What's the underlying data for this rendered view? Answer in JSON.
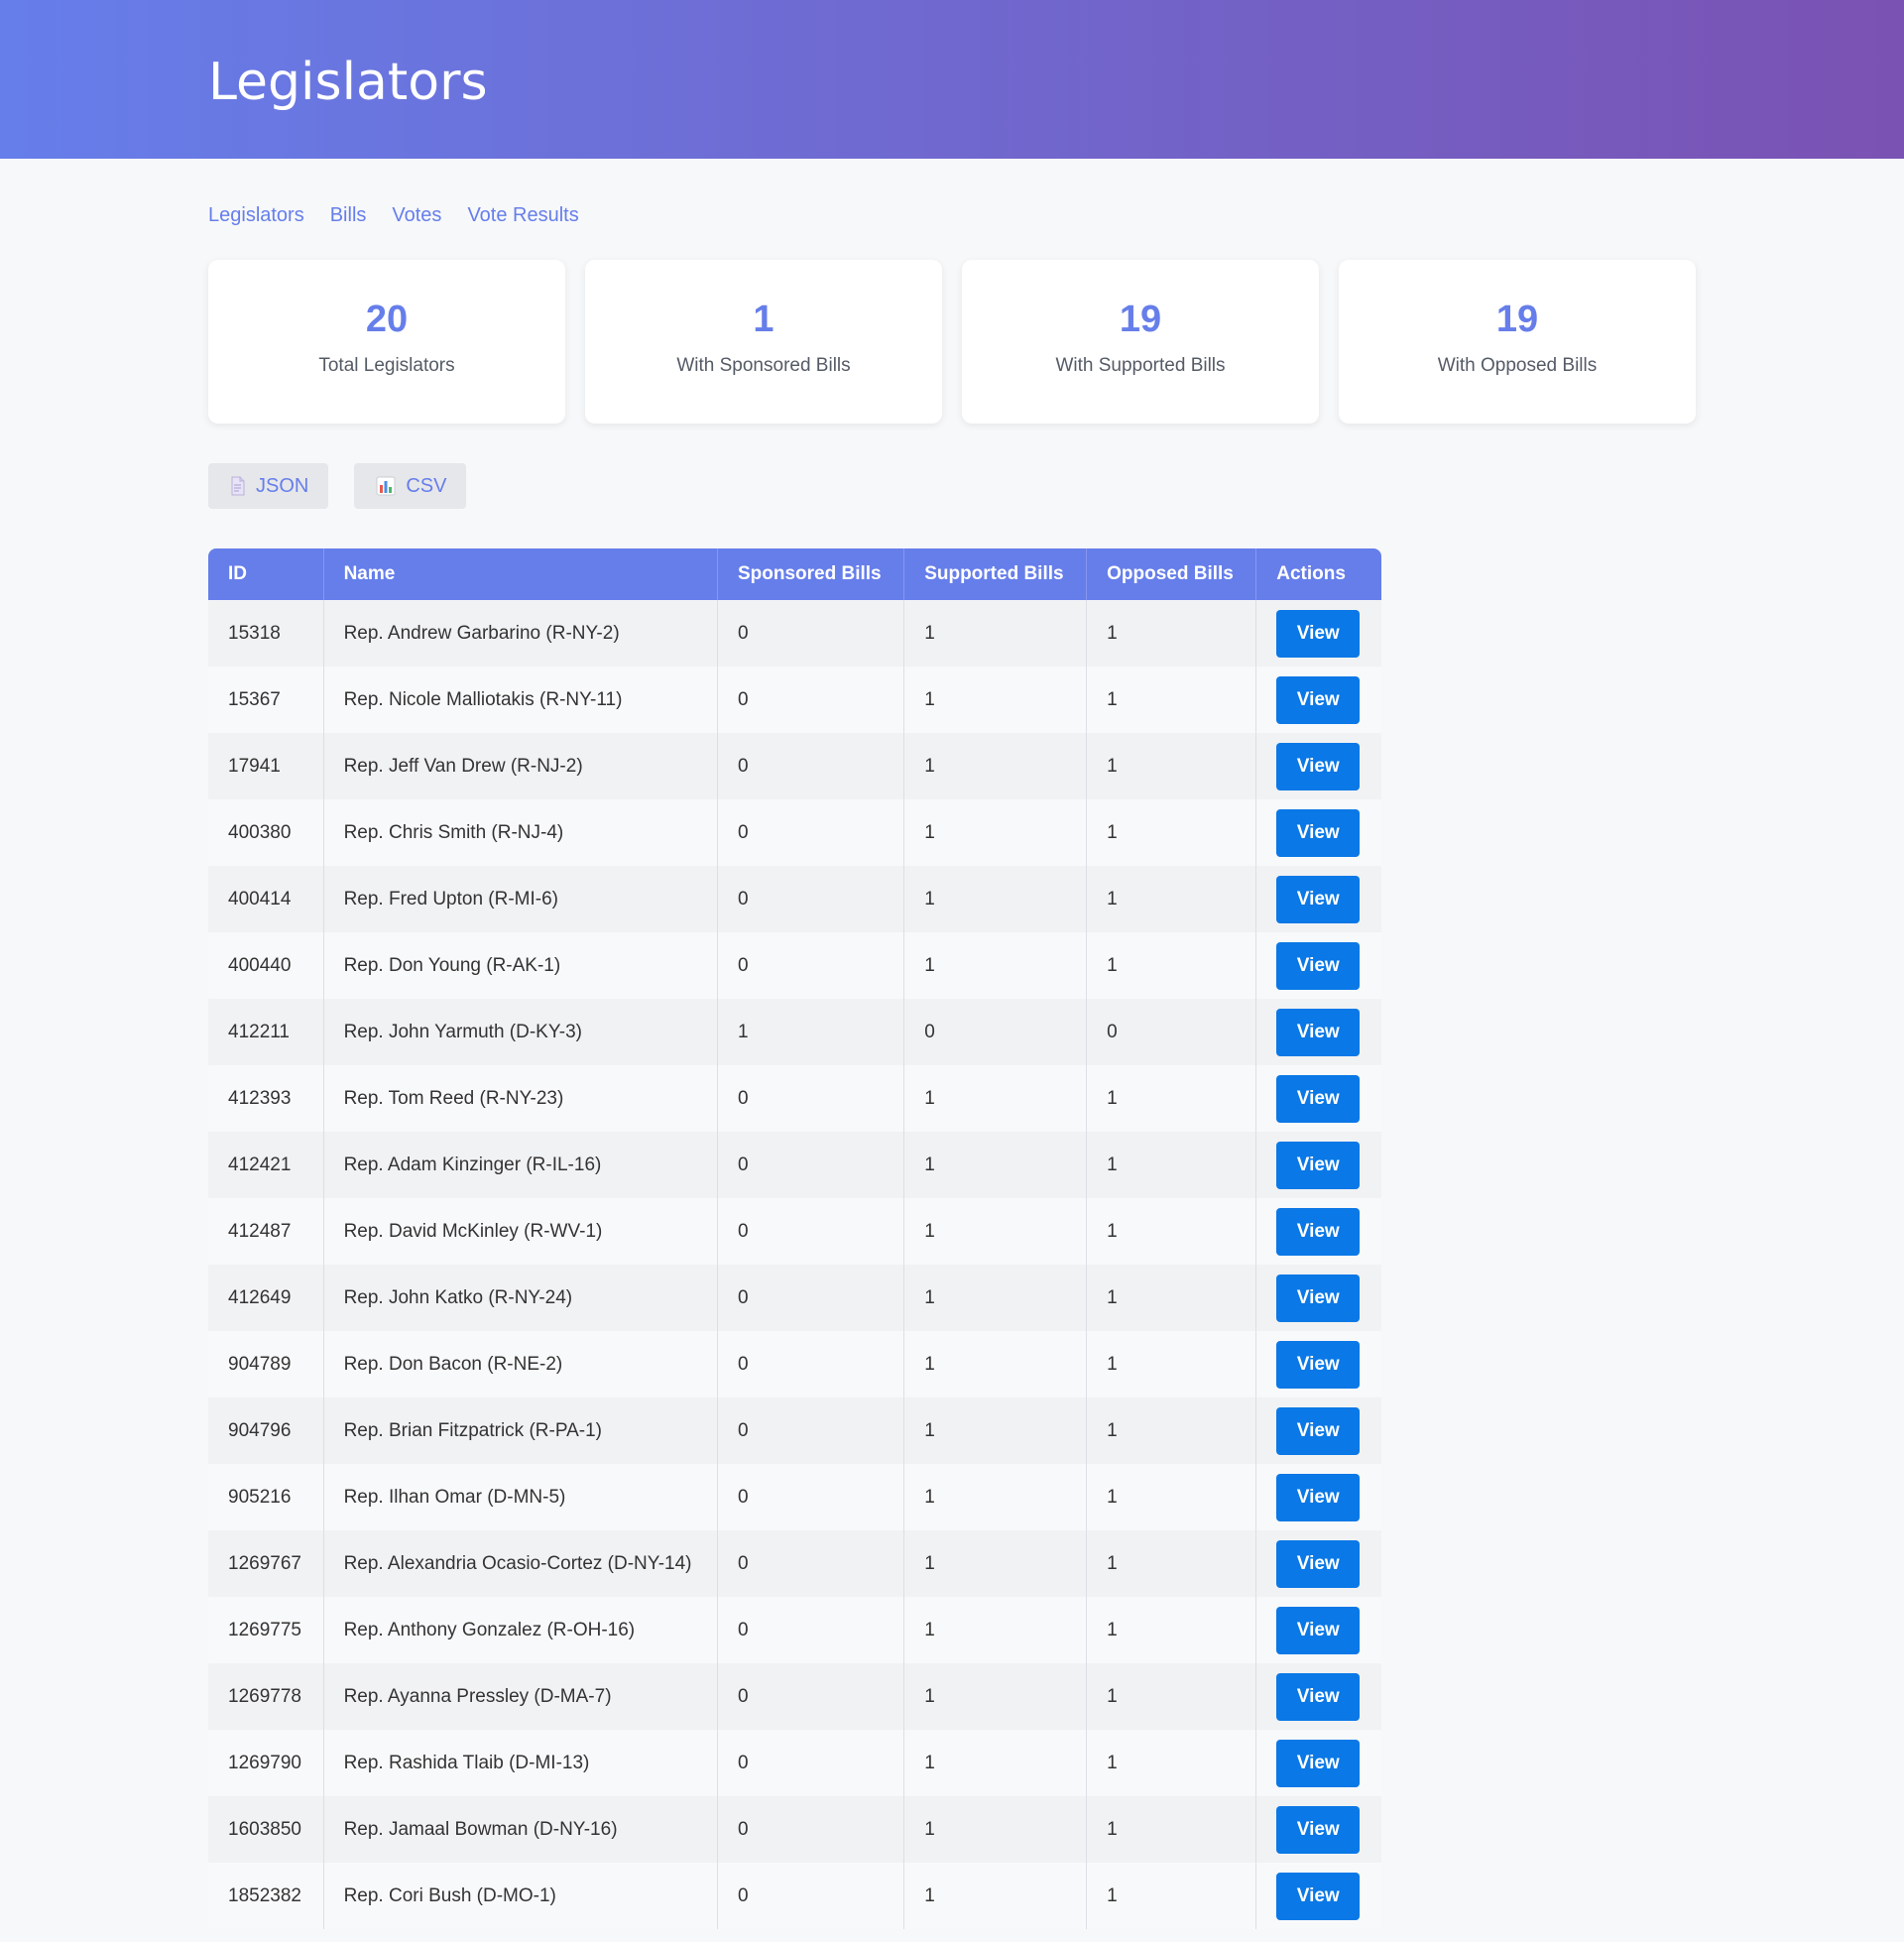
{
  "page": {
    "title": "Legislators"
  },
  "nav": [
    "Legislators",
    "Bills",
    "Votes",
    "Vote Results"
  ],
  "stats": [
    {
      "value": "20",
      "label": "Total Legislators"
    },
    {
      "value": "1",
      "label": "With Sponsored Bills"
    },
    {
      "value": "19",
      "label": "With Supported Bills"
    },
    {
      "value": "19",
      "label": "With Opposed Bills"
    }
  ],
  "exports": [
    {
      "label": "JSON",
      "icon": "document-icon"
    },
    {
      "label": "CSV",
      "icon": "bar-chart-icon"
    }
  ],
  "table": {
    "columns": [
      "ID",
      "Name",
      "Sponsored Bills",
      "Supported Bills",
      "Opposed Bills",
      "Actions"
    ],
    "action_label": "View",
    "rows": [
      {
        "id": "15318",
        "name": "Rep. Andrew Garbarino (R-NY-2)",
        "sponsored": "0",
        "supported": "1",
        "opposed": "1"
      },
      {
        "id": "15367",
        "name": "Rep. Nicole Malliotakis (R-NY-11)",
        "sponsored": "0",
        "supported": "1",
        "opposed": "1"
      },
      {
        "id": "17941",
        "name": "Rep. Jeff Van Drew (R-NJ-2)",
        "sponsored": "0",
        "supported": "1",
        "opposed": "1"
      },
      {
        "id": "400380",
        "name": "Rep. Chris Smith (R-NJ-4)",
        "sponsored": "0",
        "supported": "1",
        "opposed": "1"
      },
      {
        "id": "400414",
        "name": "Rep. Fred Upton (R-MI-6)",
        "sponsored": "0",
        "supported": "1",
        "opposed": "1"
      },
      {
        "id": "400440",
        "name": "Rep. Don Young (R-AK-1)",
        "sponsored": "0",
        "supported": "1",
        "opposed": "1"
      },
      {
        "id": "412211",
        "name": "Rep. John Yarmuth (D-KY-3)",
        "sponsored": "1",
        "supported": "0",
        "opposed": "0"
      },
      {
        "id": "412393",
        "name": "Rep. Tom Reed (R-NY-23)",
        "sponsored": "0",
        "supported": "1",
        "opposed": "1"
      },
      {
        "id": "412421",
        "name": "Rep. Adam Kinzinger (R-IL-16)",
        "sponsored": "0",
        "supported": "1",
        "opposed": "1"
      },
      {
        "id": "412487",
        "name": "Rep. David McKinley (R-WV-1)",
        "sponsored": "0",
        "supported": "1",
        "opposed": "1"
      },
      {
        "id": "412649",
        "name": "Rep. John Katko (R-NY-24)",
        "sponsored": "0",
        "supported": "1",
        "opposed": "1"
      },
      {
        "id": "904789",
        "name": "Rep. Don Bacon (R-NE-2)",
        "sponsored": "0",
        "supported": "1",
        "opposed": "1"
      },
      {
        "id": "904796",
        "name": "Rep. Brian Fitzpatrick (R-PA-1)",
        "sponsored": "0",
        "supported": "1",
        "opposed": "1"
      },
      {
        "id": "905216",
        "name": "Rep. Ilhan Omar (D-MN-5)",
        "sponsored": "0",
        "supported": "1",
        "opposed": "1"
      },
      {
        "id": "1269767",
        "name": "Rep. Alexandria Ocasio-Cortez (D-NY-14)",
        "sponsored": "0",
        "supported": "1",
        "opposed": "1"
      },
      {
        "id": "1269775",
        "name": "Rep. Anthony Gonzalez (R-OH-16)",
        "sponsored": "0",
        "supported": "1",
        "opposed": "1"
      },
      {
        "id": "1269778",
        "name": "Rep. Ayanna Pressley (D-MA-7)",
        "sponsored": "0",
        "supported": "1",
        "opposed": "1"
      },
      {
        "id": "1269790",
        "name": "Rep. Rashida Tlaib (D-MI-13)",
        "sponsored": "0",
        "supported": "1",
        "opposed": "1"
      },
      {
        "id": "1603850",
        "name": "Rep. Jamaal Bowman (D-NY-16)",
        "sponsored": "0",
        "supported": "1",
        "opposed": "1"
      },
      {
        "id": "1852382",
        "name": "Rep. Cori Bush (D-MO-1)",
        "sponsored": "0",
        "supported": "1",
        "opposed": "1"
      }
    ]
  },
  "colors": {
    "accent": "#667eea",
    "header_gradient_start": "#667eea",
    "header_gradient_end": "#7a52b3",
    "view_button": "#0a78e6"
  }
}
